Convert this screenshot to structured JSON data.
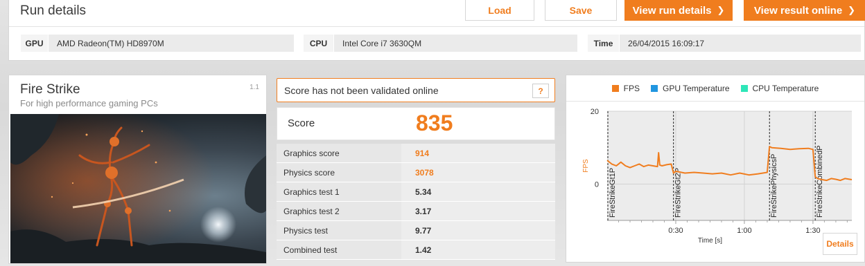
{
  "header": {
    "title": "Run details",
    "buttons": {
      "load": "Load",
      "save": "Save",
      "view_run_details": "View run details",
      "view_result_online": "View result online"
    }
  },
  "system": {
    "gpu_label": "GPU",
    "gpu_value": "AMD Radeon(TM) HD8970M",
    "cpu_label": "CPU",
    "cpu_value": "Intel Core i7 3630QM",
    "time_label": "Time",
    "time_value": "26/04/2015 16:09:17"
  },
  "test": {
    "name": "Fire Strike",
    "subtitle": "For high performance gaming PCs",
    "version": "1.1"
  },
  "score": {
    "warning": "Score has not been validated online",
    "help": "?",
    "label": "Score",
    "value": "835",
    "rows": [
      {
        "label": "Graphics score",
        "value": "914"
      },
      {
        "label": "Physics score",
        "value": "3078"
      },
      {
        "label": "Graphics test 1",
        "value": "5.34"
      },
      {
        "label": "Graphics test 2",
        "value": "3.17"
      },
      {
        "label": "Physics test",
        "value": "9.77"
      },
      {
        "label": "Combined test",
        "value": "1.42"
      }
    ]
  },
  "chart_panel": {
    "details_label": "Details"
  },
  "colors": {
    "accent": "#f07d1e",
    "gpu_temp": "#2196e0",
    "cpu_temp": "#2ee6b8"
  },
  "chart_data": {
    "type": "line",
    "ylabel": "FPS",
    "xlabel": "Time [s]",
    "ylim": [
      -10,
      20
    ],
    "xlim": [
      0,
      107
    ],
    "yticks": [
      "20",
      "0"
    ],
    "yticks_values": [
      20,
      0
    ],
    "xticks": [
      "0:30",
      "1:00",
      "1:30"
    ],
    "xticks_values": [
      30,
      60,
      90
    ],
    "grid": true,
    "legend_position": "top",
    "legend": [
      {
        "name": "FPS",
        "color": "#f07d1e"
      },
      {
        "name": "GPU Temperature",
        "color": "#2196e0"
      },
      {
        "name": "CPU Temperature",
        "color": "#2ee6b8"
      }
    ],
    "markers": [
      {
        "label": "FireStrikeGt1P",
        "x": 0
      },
      {
        "label": "FireStrikeGt2P",
        "x": 29
      },
      {
        "label": "FireStrikePhysicsP",
        "x": 71
      },
      {
        "label": "FireStrikeCombinedP",
        "x": 91
      }
    ],
    "series": [
      {
        "name": "FPS",
        "x": [
          0,
          2,
          4,
          6,
          8,
          10,
          12,
          14,
          16,
          18,
          20,
          22,
          22.5,
          23,
          24,
          26,
          28,
          29,
          30,
          34,
          38,
          42,
          46,
          50,
          54,
          58,
          62,
          66,
          70,
          71,
          72,
          76,
          80,
          84,
          88,
          90,
          91,
          92,
          94,
          96,
          98,
          100,
          102,
          104,
          107
        ],
        "y": [
          6.5,
          5.5,
          5.0,
          6.0,
          5.0,
          4.5,
          5.0,
          5.5,
          4.8,
          5.2,
          5.0,
          4.8,
          8.6,
          5.2,
          5.0,
          5.3,
          5.5,
          3.0,
          3.5,
          3.0,
          3.2,
          3.0,
          2.8,
          3.0,
          2.5,
          3.0,
          2.5,
          2.8,
          3.2,
          10.3,
          10.0,
          9.8,
          9.5,
          9.7,
          9.8,
          9.5,
          2.0,
          1.5,
          1.2,
          1.0,
          1.5,
          1.3,
          1.0,
          1.5,
          1.2
        ]
      }
    ]
  }
}
